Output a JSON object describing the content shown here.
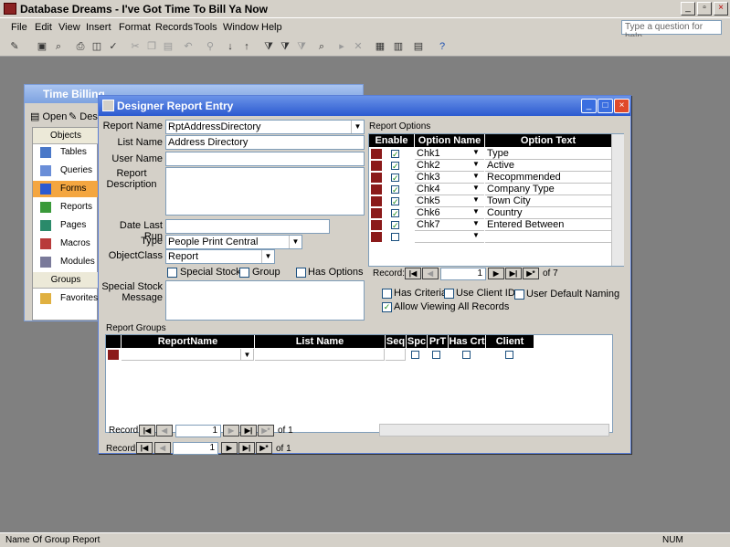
{
  "app": {
    "title": "Database Dreams - I've Got Time To Bill Ya Now",
    "question_placeholder": "Type a question for help"
  },
  "menu": [
    "File",
    "Edit",
    "View",
    "Insert",
    "Format",
    "Records",
    "Tools",
    "Window",
    "Help"
  ],
  "status": {
    "left": "Name Of Group Report",
    "right": "NUM"
  },
  "dbwindow": {
    "title": "Time Billing",
    "toolbar": {
      "open": "Open",
      "design": "Desig"
    },
    "objects_header": "Objects",
    "items": [
      "Tables",
      "Queries",
      "Forms",
      "Reports",
      "Pages",
      "Macros",
      "Modules"
    ],
    "groups_header": "Groups",
    "favorites": "Favorites"
  },
  "form": {
    "title": "Designer Report Entry",
    "labels": {
      "report_name": "Report Name",
      "list_name": "List Name",
      "user_name": "User Name",
      "report_description": "Report Description",
      "date_last_run": "Date Last Run",
      "type": "Type",
      "object_class": "ObjectClass",
      "special_stock_message": "Special Stock Message",
      "report_options": "Report Options",
      "report_groups": "Report Groups"
    },
    "values": {
      "report_name": "RptAddressDirectory",
      "list_name": "Address Directory",
      "user_name": "",
      "report_description": "",
      "date_last_run": "",
      "type": "People Print Central",
      "object_class": "Report",
      "special_stock_message": ""
    },
    "checks": {
      "special_stock": "Special Stock",
      "group": "Group",
      "has_options": "Has Options",
      "has_criteria": "Has Criteria",
      "use_client_id": "Use Client ID",
      "user_default_naming": "User Default Naming",
      "allow_viewing": "Allow Viewing All Records"
    },
    "options_grid": {
      "headers": [
        "Enable",
        "Option Name",
        "Option Text"
      ],
      "rows": [
        {
          "name": "Chk1",
          "text": "Type"
        },
        {
          "name": "Chk2",
          "text": "Active"
        },
        {
          "name": "Chk3",
          "text": "Recopmmended"
        },
        {
          "name": "Chk4",
          "text": "Company Type"
        },
        {
          "name": "Chk5",
          "text": "Town City"
        },
        {
          "name": "Chk6",
          "text": "Country"
        },
        {
          "name": "Chk7",
          "text": "Entered Between"
        }
      ],
      "nav": {
        "record_label": "Record:",
        "current": "1",
        "of": "of 7"
      }
    },
    "groups_grid": {
      "headers": [
        "ReportName",
        "List Name",
        "Seq",
        "Spc",
        "PrT",
        "Has Crt",
        "Client CRT"
      ],
      "nav": {
        "record_label": "Record:",
        "current": "1",
        "of": "of 1"
      }
    },
    "main_nav": {
      "record_label": "Record:",
      "current": "1",
      "of": "of 1"
    }
  }
}
